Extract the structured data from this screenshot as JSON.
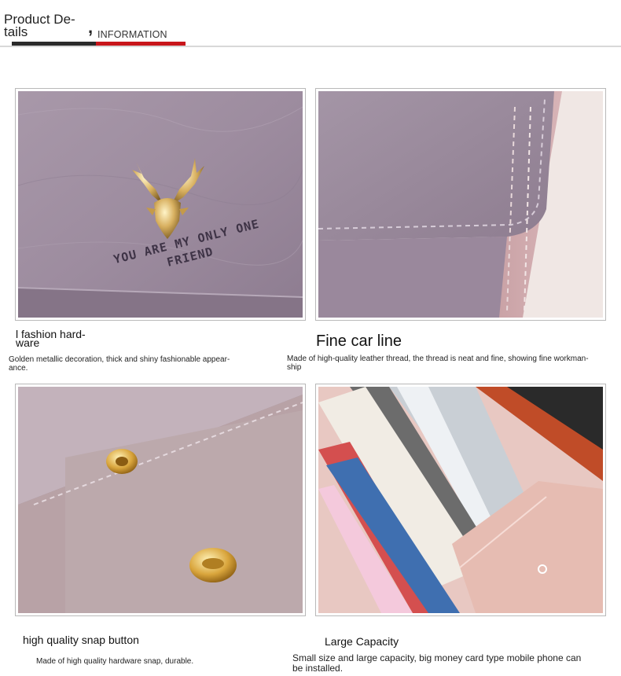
{
  "header": {
    "title": "Product De-\ntails",
    "comma": ",",
    "subtitle": "INFORMATION",
    "colors": {
      "dark_bar": "#2a2a2a",
      "accent_bar": "#c8151b",
      "rule": "#d8d8d8"
    }
  },
  "panels": [
    {
      "image": "wallet-deer-emblem-photo",
      "embossed_text_line1": "YOU ARE MY ONLY ONE",
      "embossed_text_line2": "FRIEND",
      "title": "l fashion hard-\nware",
      "description": "Golden metallic decoration, thick and shiny fashionable appear-\nance."
    },
    {
      "image": "wallet-stitching-photo",
      "title": "Fine car line",
      "description": "Made of high-quality leather thread, the thread is neat and fine, showing fine workman-\nship"
    },
    {
      "image": "wallet-snap-button-photo",
      "title": "high quality snap button",
      "description": "Made of high quality hardware snap, durable."
    },
    {
      "image": "wallet-interior-capacity-photo",
      "title": "Large Capacity",
      "description": "Small size and large capacity, big money card type mobile phone can\nbe installed."
    }
  ]
}
